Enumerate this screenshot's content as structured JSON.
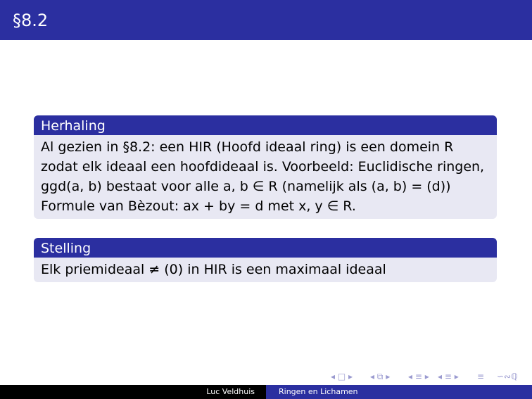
{
  "slide": {
    "title": "§8.2"
  },
  "blocks": [
    {
      "heading": "Herhaling",
      "lines": [
        "Al gezien in §8.2: een HIR (Hoofd ideaal ring) is een domein R",
        "zodat elk ideaal een hoofdideaal is. Voorbeeld: Euclidische ringen,",
        "ggd(a, b) bestaat voor alle a, b ∈ R (namelijk als (a, b) = (d))",
        "Formule van Bèzout: ax + by = d met x, y ∈ R."
      ]
    },
    {
      "heading": "Stelling",
      "lines": [
        "Elk priemideaal ≠ (0) in HIR is een maximaal ideaal"
      ]
    }
  ],
  "navigation": {
    "frame_prev": "◂ □ ▸",
    "subsection_prev": "◂ ⧉ ▸",
    "section": "◂ ≡ ▸",
    "subsection_next": "◂ ≡ ▸",
    "align": "≡",
    "search": "∽∾ℚ"
  },
  "footer": {
    "author": "Luc Veldhuis",
    "title": "Ringen en Lichamen"
  },
  "colors": {
    "theme": "#2b2fa0",
    "block_body": "#e8e8f3",
    "footer_dark": "#000000"
  }
}
